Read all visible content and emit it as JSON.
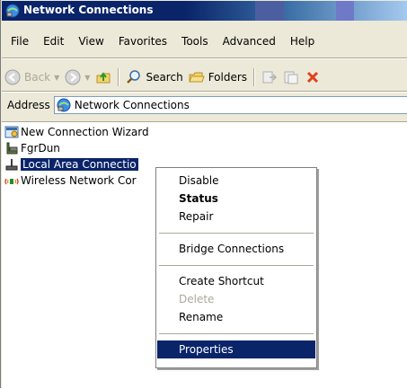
{
  "window": {
    "title": "Network Connections"
  },
  "menubar": {
    "items": [
      "File",
      "Edit",
      "View",
      "Favorites",
      "Tools",
      "Advanced",
      "Help"
    ]
  },
  "toolbar": {
    "back_label": "Back",
    "search_label": "Search",
    "folders_label": "Folders"
  },
  "address": {
    "label": "Address",
    "value": "Network Connections"
  },
  "list": {
    "items": [
      {
        "label": "New Connection Wizard",
        "icon": "wizard-icon"
      },
      {
        "label": "FgrDun",
        "icon": "dialup-icon"
      },
      {
        "label": "Local Area Connectio",
        "icon": "lan-icon",
        "selected": true
      },
      {
        "label": "Wireless Network Cor",
        "icon": "wireless-icon"
      }
    ]
  },
  "context_menu": {
    "items": [
      {
        "label": "Disable"
      },
      {
        "label": "Status",
        "bold": true
      },
      {
        "label": "Repair"
      },
      {
        "label": "Bridge Connections"
      },
      {
        "label": "Create Shortcut"
      },
      {
        "label": "Delete",
        "disabled": true
      },
      {
        "label": "Rename"
      },
      {
        "label": "Properties",
        "highlighted": true
      }
    ]
  },
  "colors": {
    "title_bar": "#0a246a",
    "selection": "#0a246a",
    "window_bg": "#ece9d8"
  }
}
